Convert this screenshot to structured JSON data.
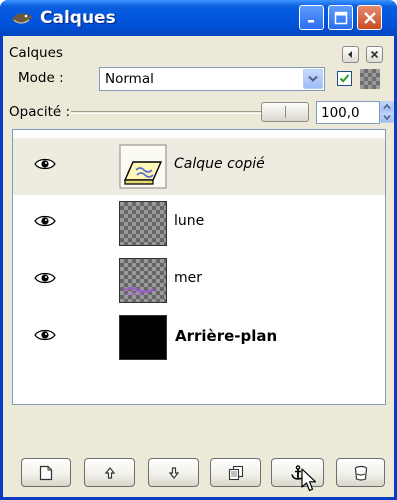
{
  "window": {
    "title": "Calques"
  },
  "panel": {
    "heading": "Calques"
  },
  "mode": {
    "label": "Mode :",
    "value": "Normal",
    "keep_transparency_checked": true
  },
  "opacity": {
    "label": "Opacité :",
    "value": "100,0",
    "fraction": 1.0
  },
  "layers": [
    {
      "name": "Calque copié",
      "visible": true,
      "selected": true,
      "style": "italic",
      "thumbnail": "floating-selection-icon"
    },
    {
      "name": "lune",
      "visible": true,
      "selected": false,
      "style": "normal",
      "thumbnail": "transparent-checker"
    },
    {
      "name": "mer",
      "visible": true,
      "selected": false,
      "style": "normal",
      "thumbnail": "transparent-checker-purple"
    },
    {
      "name": "Arrière-plan",
      "visible": true,
      "selected": false,
      "style": "bold",
      "thumbnail": "black"
    }
  ],
  "toolbar": {
    "buttons": [
      "new-layer-icon",
      "raise-layer-icon",
      "lower-layer-icon",
      "duplicate-layer-icon",
      "anchor-layer-icon",
      "delete-layer-icon"
    ]
  },
  "colors": {
    "titlebar": "#0358e0",
    "selected_row": "#eeebe1",
    "window_bg": "#ece9d8"
  }
}
